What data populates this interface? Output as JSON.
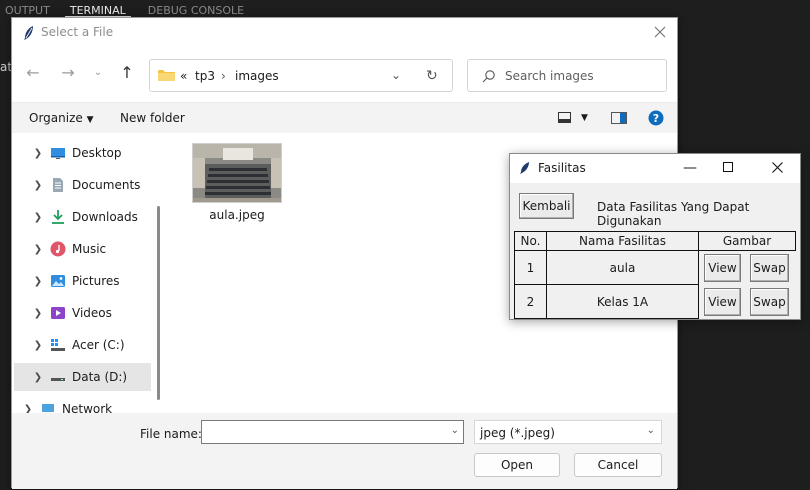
{
  "vscode": {
    "tabs": [
      "OUTPUT",
      "TERMINAL",
      "DEBUG CONSOLE"
    ],
    "side_text": "at"
  },
  "dialog": {
    "title": "Select a File",
    "address": {
      "chevron": "«",
      "crumbs": [
        "tp3",
        "images"
      ]
    },
    "search_placeholder": "Search images",
    "organize_label": "Organize",
    "new_folder_label": "New folder",
    "nav_items": [
      {
        "label": "Desktop",
        "icon": "desktop-icon"
      },
      {
        "label": "Documents",
        "icon": "documents-icon"
      },
      {
        "label": "Downloads",
        "icon": "downloads-icon"
      },
      {
        "label": "Music",
        "icon": "music-icon"
      },
      {
        "label": "Pictures",
        "icon": "pictures-icon"
      },
      {
        "label": "Videos",
        "icon": "videos-icon"
      },
      {
        "label": "Acer (C:)",
        "icon": "drive-c-icon"
      },
      {
        "label": "Data (D:)",
        "icon": "drive-d-icon"
      },
      {
        "label": "Network",
        "icon": "network-icon"
      }
    ],
    "files": [
      {
        "name": "aula.jpeg"
      }
    ],
    "file_name_label": "File name:",
    "file_name_value": "",
    "file_type": "jpeg (*.jpeg)",
    "open_label": "Open",
    "cancel_label": "Cancel"
  },
  "fasilitas": {
    "title": "Fasilitas",
    "back_label": "Kembali",
    "heading": "Data Fasilitas Yang Dapat Digunakan",
    "columns": [
      "No.",
      "Nama Fasilitas",
      "Gambar"
    ],
    "rows": [
      {
        "no": "1",
        "name": "aula",
        "view": "View",
        "swap": "Swap"
      },
      {
        "no": "2",
        "name": "Kelas 1A",
        "view": "View",
        "swap": "Swap"
      }
    ]
  },
  "colors": {
    "accent": "#0067c0",
    "help": "#0f6cbd",
    "folder": "#f4c343"
  }
}
